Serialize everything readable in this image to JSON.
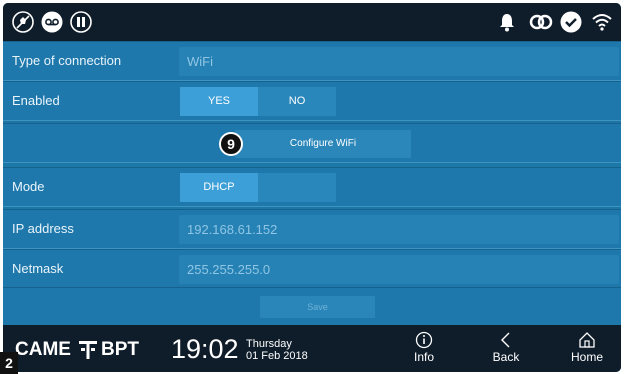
{
  "status_bar": {
    "left_icons": [
      "mute-icon",
      "voicemail-icon",
      "door-release-icon"
    ],
    "right_icons": [
      "bell-icon",
      "link-icon",
      "check-icon",
      "wifi-icon"
    ]
  },
  "settings": {
    "type_of_connection": {
      "label": "Type of connection",
      "value": "WiFi"
    },
    "enabled": {
      "label": "Enabled",
      "options": [
        "YES",
        "NO"
      ],
      "selected": "YES"
    },
    "configure": {
      "label": "Configure WiFi",
      "badge": "9"
    },
    "mode": {
      "label": "Mode",
      "options": [
        "DHCP",
        ""
      ],
      "selected": "DHCP"
    },
    "ip_address": {
      "label": "IP address",
      "value": "192.168.61.152"
    },
    "netmask": {
      "label": "Netmask",
      "value": "255.255.255.0"
    },
    "save_label": "Save"
  },
  "bottom_bar": {
    "logo_left": "CAME",
    "logo_right": "BPT",
    "time": "19:02",
    "day": "Thursday",
    "date": "01 Feb 2018",
    "info_label": "Info",
    "back_label": "Back",
    "home_label": "Home"
  },
  "figure_tag": "2",
  "colors": {
    "panel": "#1f78ab",
    "bar": "#0f1d2b",
    "selected": "#3d9fd7"
  }
}
